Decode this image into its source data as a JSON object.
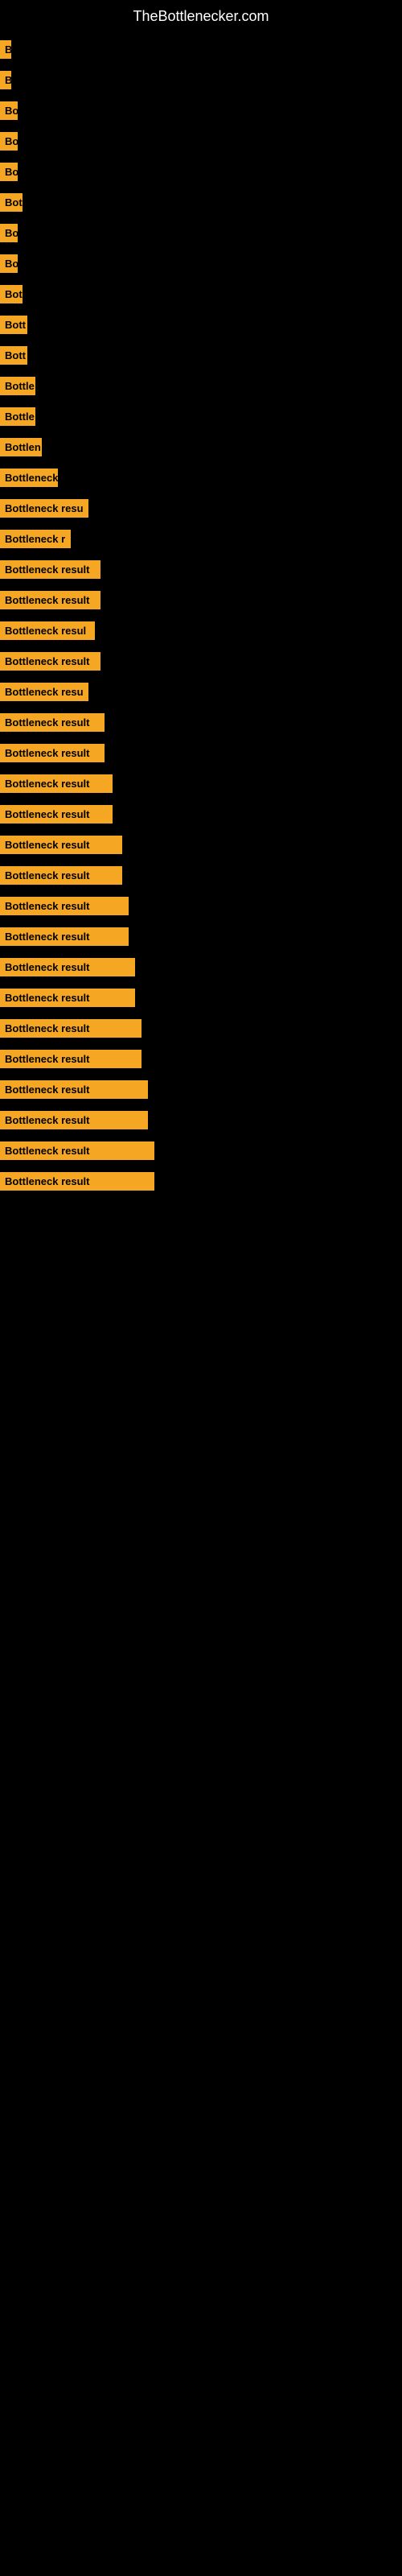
{
  "site": {
    "title": "TheBottlenecker.com"
  },
  "items": [
    {
      "label": "B",
      "width": 14
    },
    {
      "label": "B",
      "width": 14
    },
    {
      "label": "Bo",
      "width": 22
    },
    {
      "label": "Bo",
      "width": 22
    },
    {
      "label": "Bo",
      "width": 22
    },
    {
      "label": "Bot",
      "width": 28
    },
    {
      "label": "Bo",
      "width": 22
    },
    {
      "label": "Bo",
      "width": 22
    },
    {
      "label": "Bot",
      "width": 28
    },
    {
      "label": "Bott",
      "width": 34
    },
    {
      "label": "Bott",
      "width": 34
    },
    {
      "label": "Bottle",
      "width": 44
    },
    {
      "label": "Bottle",
      "width": 44
    },
    {
      "label": "Bottlen",
      "width": 52
    },
    {
      "label": "Bottleneck",
      "width": 72
    },
    {
      "label": "Bottleneck resu",
      "width": 110
    },
    {
      "label": "Bottleneck r",
      "width": 88
    },
    {
      "label": "Bottleneck result",
      "width": 125
    },
    {
      "label": "Bottleneck result",
      "width": 125
    },
    {
      "label": "Bottleneck resul",
      "width": 118
    },
    {
      "label": "Bottleneck result",
      "width": 125
    },
    {
      "label": "Bottleneck resu",
      "width": 110
    },
    {
      "label": "Bottleneck result",
      "width": 130
    },
    {
      "label": "Bottleneck result",
      "width": 130
    },
    {
      "label": "Bottleneck result",
      "width": 140
    },
    {
      "label": "Bottleneck result",
      "width": 140
    },
    {
      "label": "Bottleneck result",
      "width": 152
    },
    {
      "label": "Bottleneck result",
      "width": 152
    },
    {
      "label": "Bottleneck result",
      "width": 160
    },
    {
      "label": "Bottleneck result",
      "width": 160
    },
    {
      "label": "Bottleneck result",
      "width": 168
    },
    {
      "label": "Bottleneck result",
      "width": 168
    },
    {
      "label": "Bottleneck result",
      "width": 176
    },
    {
      "label": "Bottleneck result",
      "width": 176
    },
    {
      "label": "Bottleneck result",
      "width": 184
    },
    {
      "label": "Bottleneck result",
      "width": 184
    },
    {
      "label": "Bottleneck result",
      "width": 192
    },
    {
      "label": "Bottleneck result",
      "width": 192
    }
  ]
}
